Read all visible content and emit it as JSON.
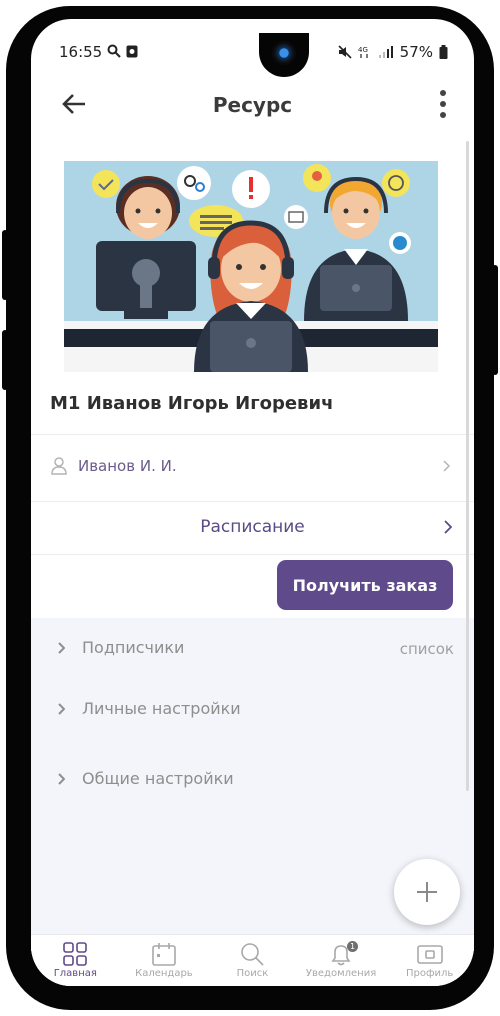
{
  "status_bar": {
    "time": "16:55",
    "battery": "57%"
  },
  "app_bar": {
    "title": "Ресурс"
  },
  "resource": {
    "name": "М1 Иванов Игорь Игоревич",
    "owner": "Иванов И. И.",
    "schedule_label": "Расписание",
    "order_button": "Получить заказ"
  },
  "sections": {
    "subscribers": "Подписчики",
    "subscribers_aux": "список",
    "personal_settings": "Личные настройки",
    "general_settings": "Общие настройки"
  },
  "bottom_nav": {
    "home": "Главная",
    "calendar": "Календарь",
    "search": "Поиск",
    "notifications": "Уведомления",
    "profile": "Профиль",
    "notification_badge": "1"
  },
  "colors": {
    "accent": "#5f4a8b",
    "section_bg": "#f3f5fb"
  }
}
